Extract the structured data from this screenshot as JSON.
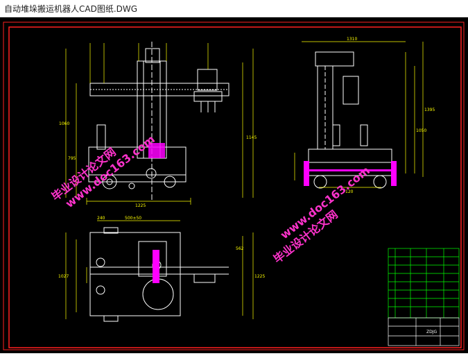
{
  "window": {
    "title": "自动堆垛搬运机器人CAD图纸.DWG"
  },
  "colors": {
    "background": "#000000",
    "frame": "#ff2020",
    "lines": "#ffffff",
    "dims": "#ffff00",
    "accent": "#ff00ff",
    "table": "#00ff00",
    "watermark": "#ff00cc"
  },
  "watermark": {
    "cn": "毕业设计论文网",
    "url": "www.doc163.com"
  },
  "dims": {
    "top_left": [
      "1060",
      "1145",
      "795",
      "1225"
    ],
    "top_right": [
      "1310",
      "1050",
      "120",
      "1395"
    ],
    "bottom": [
      "240",
      "500±50",
      "1027",
      "1225",
      "562"
    ]
  },
  "title_block": {
    "name": "ZDJG"
  }
}
